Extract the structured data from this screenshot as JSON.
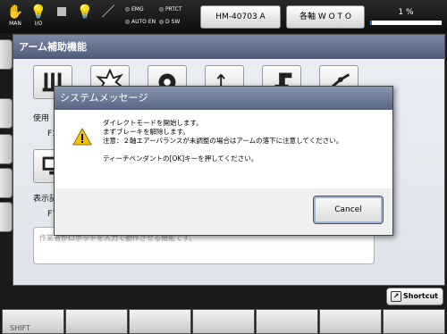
{
  "topbar": {
    "icons": [
      {
        "icon": "hand-icon",
        "caption": "MAN"
      },
      {
        "icon": "bulb-icon",
        "caption": "I/O"
      },
      {
        "icon": "stop-square-icon",
        "caption": ""
      },
      {
        "icon": "bulb-icon",
        "caption": ""
      },
      {
        "icon": "wrench-icon",
        "caption": ""
      }
    ],
    "status": [
      "EMG",
      "PRTCT",
      "AUTO EN",
      "D SW"
    ],
    "program_button": "HM-40703 A",
    "axis_button": "各軸  W O T O",
    "percent_label": "1 %",
    "percent_value": 0.01
  },
  "panel": {
    "title": "アーム補助機能",
    "label_1": "使用",
    "key_1": "F1",
    "label_2": "表示記",
    "key_2": "F7",
    "description": "作業者がロボットを入力で動作させる機能です。"
  },
  "dialog": {
    "title": "システムメッセージ",
    "lines": [
      "ダイレクトモードを開始します。",
      "まずブレーキを解除します。",
      "注意：２軸エアーバランスが未調整の場合はアームの落下に注意してください。",
      "ティーチペンダントの[OK]キーを押してください。"
    ],
    "cancel_label": "Cancel"
  },
  "bottom": {
    "shortcut_label": "Shortcut",
    "fkeys": [
      "SHIFT",
      "",
      "",
      "",
      "",
      "",
      "",
      ""
    ]
  },
  "colors": {
    "title_bar": "#5a6784",
    "progress_fill": "#2b7fd6",
    "warning_yellow": "#f4c20d"
  }
}
